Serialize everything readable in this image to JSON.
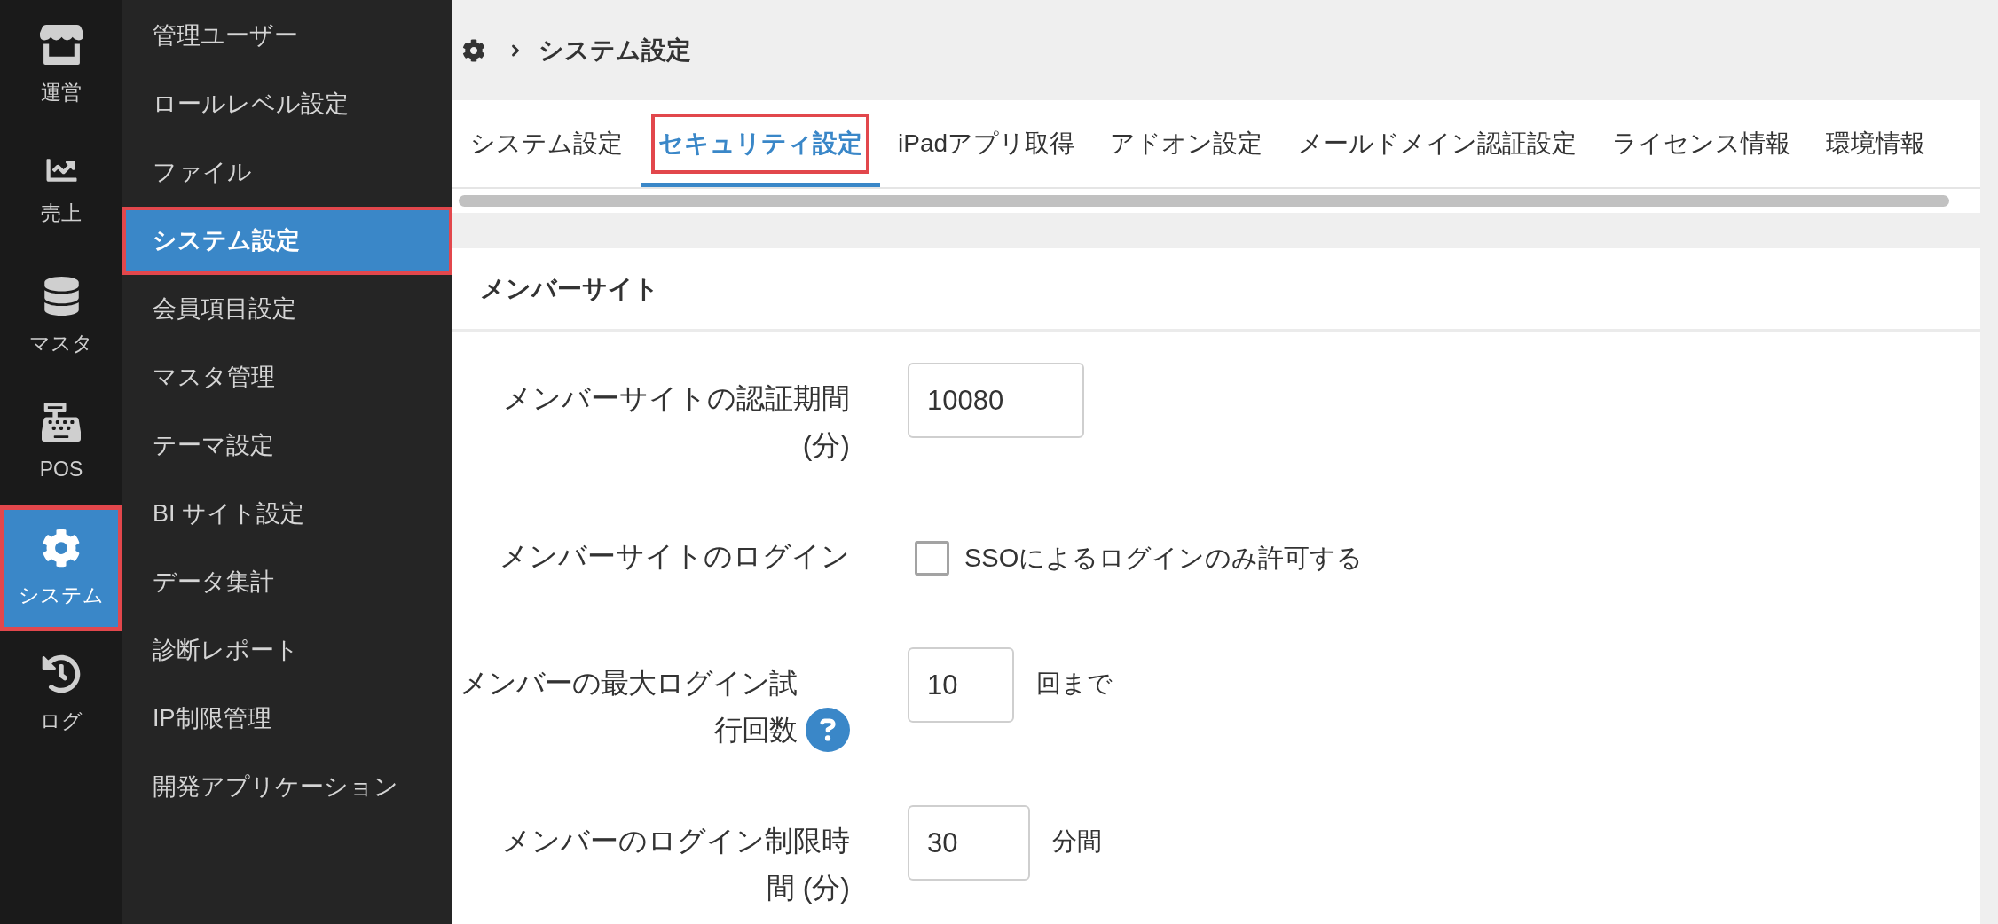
{
  "nav_rail": {
    "items": [
      {
        "label": "運営",
        "selected": false,
        "highlighted": false
      },
      {
        "label": "売上",
        "selected": false,
        "highlighted": false
      },
      {
        "label": "マスタ",
        "selected": false,
        "highlighted": false
      },
      {
        "label": "POS",
        "selected": false,
        "highlighted": false
      },
      {
        "label": "システム",
        "selected": true,
        "highlighted": true
      },
      {
        "label": "ログ",
        "selected": false,
        "highlighted": false
      }
    ]
  },
  "sidebar": {
    "items": [
      {
        "label": "管理ユーザー",
        "selected": false,
        "highlighted": false
      },
      {
        "label": "ロールレベル設定",
        "selected": false,
        "highlighted": false
      },
      {
        "label": "ファイル",
        "selected": false,
        "highlighted": false
      },
      {
        "label": "システム設定",
        "selected": true,
        "highlighted": true
      },
      {
        "label": "会員項目設定",
        "selected": false,
        "highlighted": false
      },
      {
        "label": "マスタ管理",
        "selected": false,
        "highlighted": false
      },
      {
        "label": "テーマ設定",
        "selected": false,
        "highlighted": false
      },
      {
        "label": "BI サイト設定",
        "selected": false,
        "highlighted": false
      },
      {
        "label": "データ集計",
        "selected": false,
        "highlighted": false
      },
      {
        "label": "診断レポート",
        "selected": false,
        "highlighted": false
      },
      {
        "label": "IP制限管理",
        "selected": false,
        "highlighted": false
      },
      {
        "label": "開発アプリケーション",
        "selected": false,
        "highlighted": false
      }
    ]
  },
  "breadcrumb": {
    "current": "システム設定"
  },
  "tabs": [
    {
      "label": "システム設定",
      "selected": false,
      "highlighted": false
    },
    {
      "label": "セキュリティ設定",
      "selected": true,
      "highlighted": true
    },
    {
      "label": "iPadアプリ取得",
      "selected": false,
      "highlighted": false
    },
    {
      "label": "アドオン設定",
      "selected": false,
      "highlighted": false
    },
    {
      "label": "メールドメイン認証設定",
      "selected": false,
      "highlighted": false
    },
    {
      "label": "ライセンス情報",
      "selected": false,
      "highlighted": false
    },
    {
      "label": "環境情報",
      "selected": false,
      "highlighted": false
    }
  ],
  "section": {
    "title": "メンバーサイト",
    "fields": [
      {
        "kind": "number",
        "label": "メンバーサイトの認証期間 (分)",
        "value": "10080"
      },
      {
        "kind": "checkbox",
        "label": "メンバーサイトのログイン",
        "checked": false,
        "option": "SSOによるログインのみ許可する"
      },
      {
        "kind": "number",
        "label": "メンバーの最大ログイン試行回数",
        "help": true,
        "value": "10",
        "suffix": "回まで"
      },
      {
        "kind": "number",
        "label": "メンバーのログイン制限時間 (分)",
        "value": "30",
        "suffix": "分間"
      }
    ]
  }
}
